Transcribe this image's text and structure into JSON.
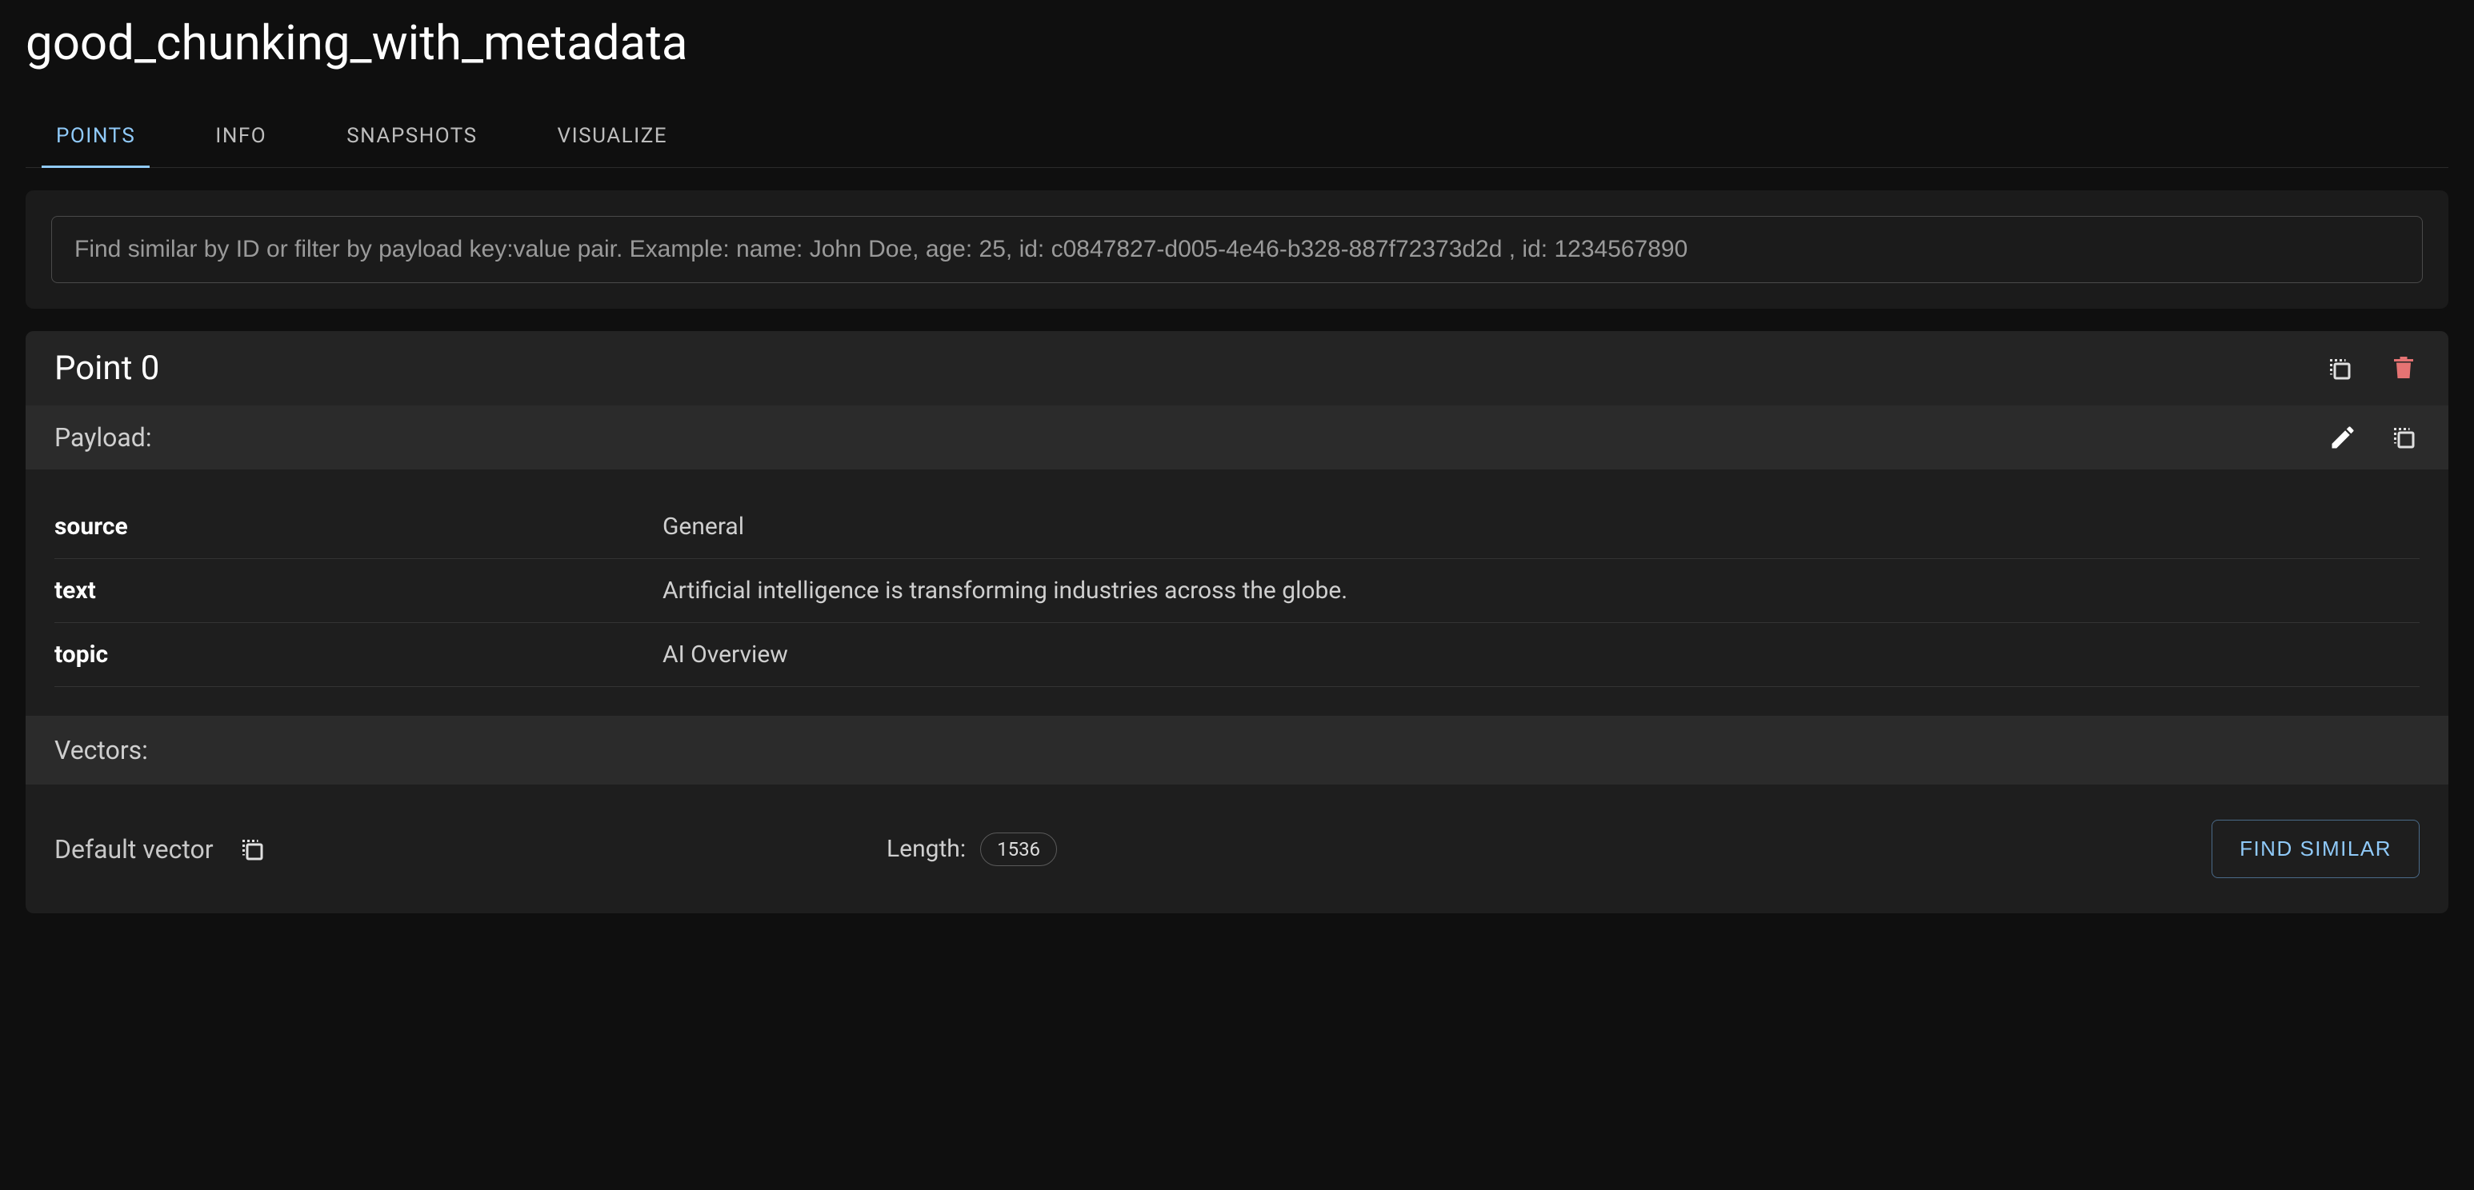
{
  "header": {
    "title": "good_chunking_with_metadata"
  },
  "tabs": [
    {
      "label": "POINTS",
      "active": true
    },
    {
      "label": "INFO",
      "active": false
    },
    {
      "label": "SNAPSHOTS",
      "active": false
    },
    {
      "label": "VISUALIZE",
      "active": false
    }
  ],
  "search": {
    "placeholder": "Find similar by ID or filter by payload key:value pair. Example: name: John Doe, age: 25, id: c0847827-d005-4e46-b328-887f72373d2d , id: 1234567890"
  },
  "point": {
    "title": "Point 0",
    "payload_label": "Payload:",
    "payload": [
      {
        "key": "source",
        "value": "General"
      },
      {
        "key": "text",
        "value": "Artificial intelligence is transforming industries across the globe."
      },
      {
        "key": "topic",
        "value": "AI Overview"
      }
    ],
    "vectors_label": "Vectors:",
    "vector": {
      "name": "Default vector",
      "length_label": "Length:",
      "length": "1536",
      "action_label": "FIND SIMILAR"
    }
  },
  "icons": {
    "copy": "copy-icon",
    "delete": "delete-icon",
    "edit": "edit-icon"
  },
  "colors": {
    "accent": "#90caf9",
    "danger": "#e57373",
    "bg": "#0f0f0f",
    "panel": "#1e1e1e",
    "panel2": "#2b2b2b"
  }
}
